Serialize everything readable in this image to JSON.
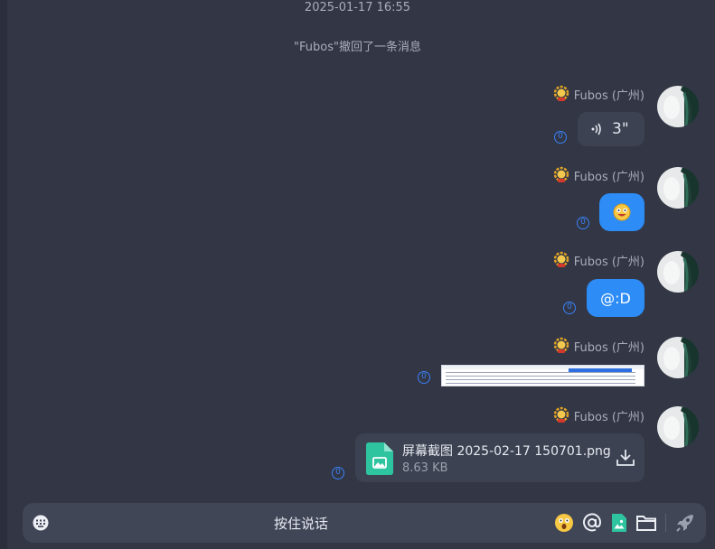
{
  "timestamp": "2025-01-17 16:55",
  "recall_notice": "\"Fubos\"撤回了一条消息",
  "messages": [
    {
      "sender": "Fubos (广州)",
      "type": "voice",
      "duration": "3\"",
      "read_count": "0"
    },
    {
      "sender": "Fubos (广州)",
      "type": "emoji",
      "read_count": "0"
    },
    {
      "sender": "Fubos (广州)",
      "type": "text",
      "text": "@:D",
      "read_count": "0"
    },
    {
      "sender": "Fubos (广州)",
      "type": "image",
      "read_count": "0"
    },
    {
      "sender": "Fubos (广州)",
      "type": "file",
      "file_name": "屏幕截图 2025-02-17 150701.png",
      "file_size": "8.63 KB",
      "read_count": "0"
    }
  ],
  "input_bar": {
    "hold_to_talk": "按住说话",
    "icons": [
      "keyboard-icon",
      "emoji-icon",
      "mention-icon",
      "image-icon",
      "folder-icon",
      "send-rocket-icon"
    ]
  },
  "colors": {
    "background": "#323645",
    "bubble_blue": "#2d8cf5",
    "bubble_gray": "#3d4252",
    "accent_read": "#3b82f6"
  }
}
